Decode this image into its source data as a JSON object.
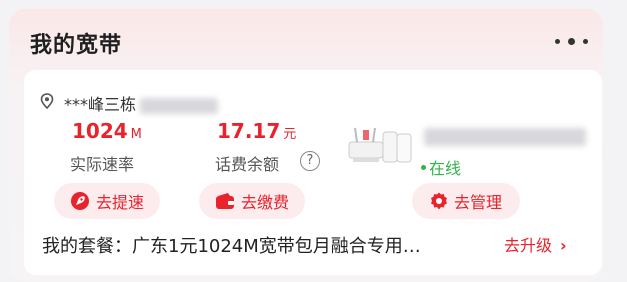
{
  "header": {
    "title": "我的宽带"
  },
  "broadband": {
    "address": "***峰三栋",
    "speed": {
      "value": "1024",
      "unit": "M",
      "label": "实际速率"
    },
    "balance": {
      "value": "17.17",
      "unit": "元",
      "label": "话费余额"
    },
    "status": "在线",
    "actions": [
      {
        "label": "去提速",
        "icon": "rocket-icon"
      },
      {
        "label": "去缴费",
        "icon": "wallet-icon"
      },
      {
        "label": "去管理",
        "icon": "gear-icon"
      }
    ],
    "plan_label": "我的套餐：",
    "plan_value": "广东1元1024M宽带包月融合专用…",
    "upgrade_label": "去升级"
  },
  "colors": {
    "accent": "#e8232c",
    "online": "#32b449",
    "button_bg": "#fdecee"
  }
}
